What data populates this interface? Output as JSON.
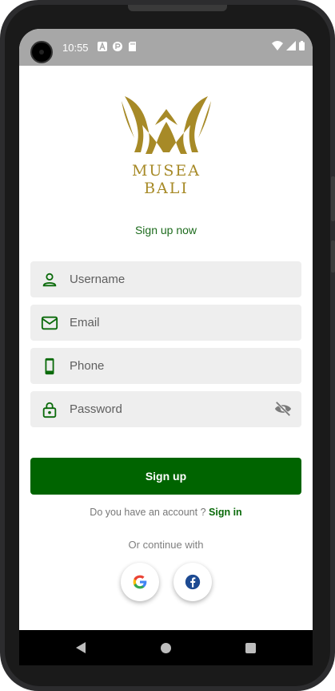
{
  "status_bar": {
    "time": "10:55"
  },
  "logo": {
    "line1": "MUSEA",
    "line2": "BALI"
  },
  "subtitle": "Sign up now",
  "form": {
    "username_placeholder": "Username",
    "email_placeholder": "Email",
    "phone_placeholder": "Phone",
    "password_placeholder": "Password"
  },
  "signup_button": "Sign up",
  "account_prompt": "Do you have an account ? ",
  "signin_link": "Sign in",
  "continue_text": "Or continue with",
  "icons": {
    "username": "person-icon",
    "email": "mail-icon",
    "phone": "phone-icon",
    "password": "lock-icon",
    "toggle": "eye-off-icon",
    "google": "google-icon",
    "facebook": "facebook-icon"
  },
  "colors": {
    "primary": "#006400",
    "accent_text": "#1d6b1d",
    "logo_gold": "#a78a27",
    "field_bg": "#eeeeee",
    "status_bar": "#a7a7a7"
  }
}
